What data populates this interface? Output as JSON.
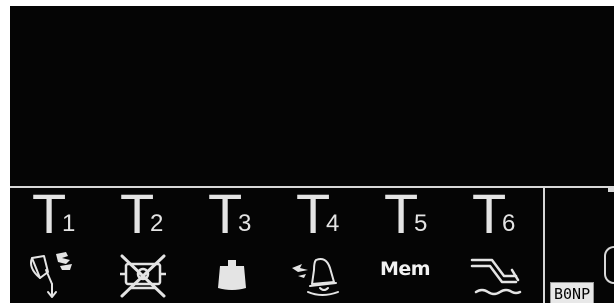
{
  "colors": {
    "screen_background": "#050505",
    "foreground": "#e4e4e4",
    "frame": "#ffffff"
  },
  "softkeys": [
    {
      "letter": "T",
      "number": "1",
      "icon": "horn-bell-icon"
    },
    {
      "letter": "T",
      "number": "2",
      "icon": "crossed-out-fan-icon"
    },
    {
      "letter": "T",
      "number": "3",
      "icon": "weight-icon"
    },
    {
      "letter": "T",
      "number": "4",
      "icon": "alarm-bell-icon"
    },
    {
      "letter": "T",
      "number": "5",
      "icon": "memory-icon",
      "text": "Mem"
    },
    {
      "letter": "T",
      "number": "6",
      "icon": "level-water-icon"
    }
  ],
  "status": {
    "corner_label": "B0NP"
  }
}
